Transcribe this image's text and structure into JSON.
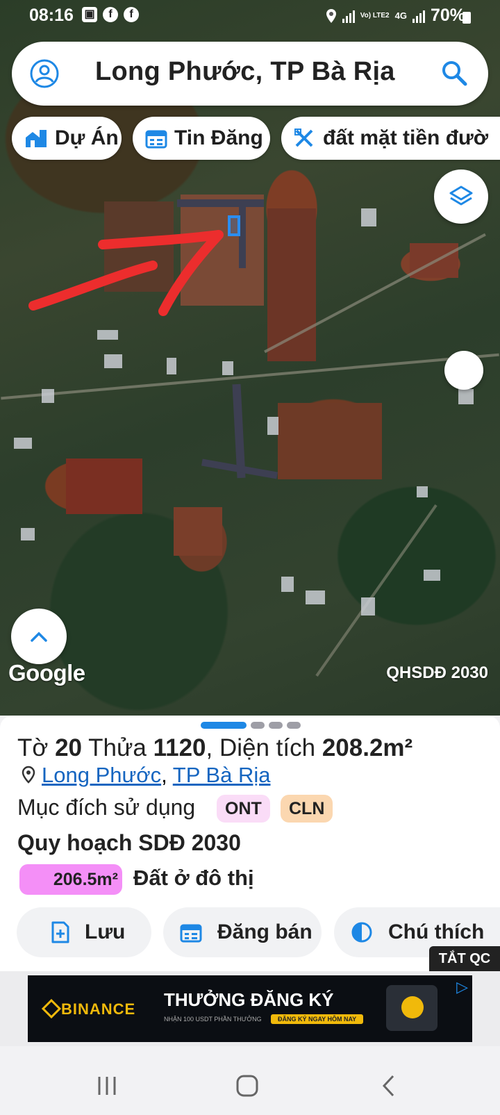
{
  "status_bar": {
    "time": "08:16",
    "network": "Vo) LTE2",
    "network_type": "4G",
    "battery": "70%"
  },
  "search": {
    "title": "Long Phước, TP Bà Rịa"
  },
  "chips": [
    {
      "label": "Dự Án",
      "icon": "building-icon"
    },
    {
      "label": "Tin Đăng",
      "icon": "calendar-icon"
    },
    {
      "label": "đất mặt tiền đườ",
      "icon": "ruler-pencil-icon"
    }
  ],
  "map": {
    "attribution": "Google",
    "overlay_label": "QHSDĐ 2030"
  },
  "parcel": {
    "sheet_prefix": "Tờ",
    "sheet_no": "20",
    "parcel_prefix": "Thửa",
    "parcel_no": "1120",
    "area_prefix": ", Diện tích",
    "area": "208.2m²",
    "location_link_1": "Long Phước",
    "location_sep": ",",
    "location_link_2": "TP Bà Rịa",
    "usage_label": "Mục đích sử dụng",
    "usage_tags": [
      {
        "label": "ONT",
        "color": "#fadcf7"
      },
      {
        "label": "CLN",
        "color": "#fbd7b0"
      }
    ],
    "plan_title": "Quy hoạch SDĐ 2030",
    "plan_area": "206.5m²",
    "plan_area_color": "#f48ff7",
    "plan_type": "Đất ở đô thị"
  },
  "actions": [
    {
      "label": "Lưu",
      "icon": "bookmark-add-icon"
    },
    {
      "label": "Đăng bán",
      "icon": "calendar-icon"
    },
    {
      "label": "Chú thích",
      "icon": "contrast-icon"
    }
  ],
  "ad": {
    "close_label": "TẮT QC",
    "brand": "BINANCE",
    "headline": "THƯỞNG ĐĂNG KÝ",
    "subline": "NHẬN 100 USDT PHẦN THƯỞNG",
    "cta": "ĐĂNG KÝ NGAY HÔM NAY"
  },
  "colors": {
    "accent": "#1e88e5",
    "link": "#1565c0",
    "arrow": "#ec2d2d"
  }
}
